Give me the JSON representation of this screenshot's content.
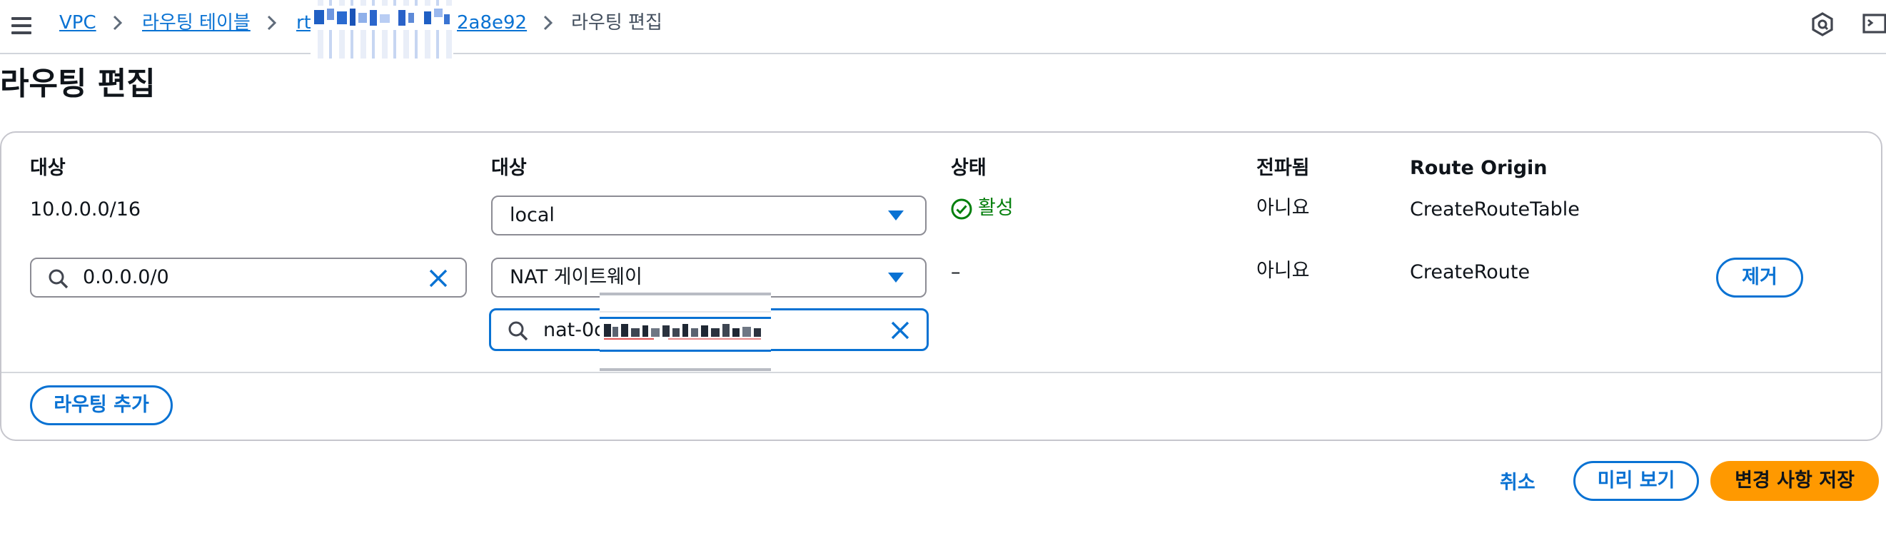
{
  "breadcrumb": {
    "items": [
      "VPC",
      "라우팅 테이블",
      "rt",
      "2a8e92",
      "라우팅 편집"
    ]
  },
  "page": {
    "title": "라우팅 편집"
  },
  "routes": {
    "headers": [
      "대상",
      "대상",
      "상태",
      "전파됨",
      "Route Origin"
    ],
    "rows": [
      {
        "destination": "10.0.0.0/16",
        "target": "local",
        "status": "활성",
        "propagated": "아니요",
        "origin": "CreateRouteTable"
      },
      {
        "destination": "0.0.0.0/0",
        "target": "NAT 게이트웨이",
        "target_search": "nat-0d",
        "status": "–",
        "propagated": "아니요",
        "origin": "CreateRoute",
        "remove_label": "제거"
      }
    ],
    "add_label": "라우팅 추가"
  },
  "footer": {
    "cancel_label": "취소",
    "preview_label": "미리 보기",
    "save_label": "변경 사항 저장"
  },
  "colors": {
    "accent": "#0972d3",
    "primary_button": "#ff9900",
    "success": "#037f0c"
  },
  "icons": [
    "menu-icon",
    "chevron-right-icon",
    "search-icon",
    "clear-icon",
    "caret-down-icon",
    "check-circle-icon",
    "notification-icon",
    "cloudshell-icon"
  ]
}
